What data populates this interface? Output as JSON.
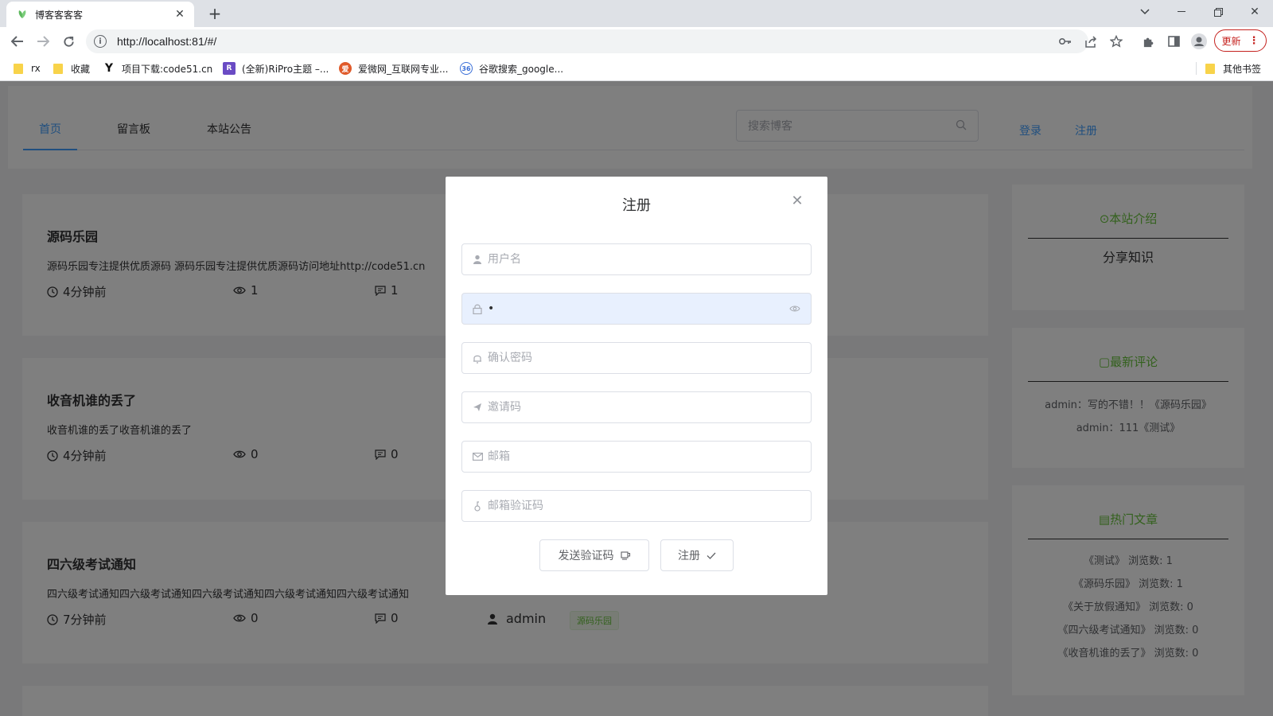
{
  "browser": {
    "tab_title": "博客客客客",
    "url": "http://localhost:81/#/",
    "update_label": "更新",
    "bookmarks": [
      "rx",
      "收藏",
      "项目下载:code51.cn",
      "(全新)RiPro主题 –...",
      "爱微网_互联网专业...",
      "谷歌搜索_google...",
      "其他书签"
    ]
  },
  "header": {
    "tabs": [
      "首页",
      "留言板",
      "本站公告"
    ],
    "search_placeholder": "搜索博客",
    "login": "登录",
    "register": "注册"
  },
  "posts": [
    {
      "title": "源码乐园",
      "excerpt": "源码乐园专注提供优质源码 源码乐园专注提供优质源码访问地址http://code51.cn",
      "time": "4分钟前",
      "views": "1",
      "comments": "1"
    },
    {
      "title": "收音机谁的丢了",
      "excerpt": "收音机谁的丢了收音机谁的丢了",
      "time": "4分钟前",
      "views": "0",
      "comments": "0"
    },
    {
      "title": "四六级考试通知",
      "excerpt": "四六级考试通知四六级考试通知四六级考试通知四六级考试通知四六级考试通知",
      "time": "7分钟前",
      "views": "0",
      "comments": "0",
      "author": "admin",
      "tag": "源码乐园"
    }
  ],
  "sidebar": {
    "intro": {
      "title": "本站介绍",
      "text": "分享知识"
    },
    "comments": {
      "title": "最新评论",
      "items": [
        "admin：写的不错！！《源码乐园》",
        "admin：111《测试》"
      ]
    },
    "hot": {
      "title": "热门文章",
      "items": [
        "《测试》 浏览数: 1",
        "《源码乐园》 浏览数: 1",
        "《关于放假通知》 浏览数: 0",
        "《四六级考试通知》 浏览数: 0",
        "《收音机谁的丢了》 浏览数: 0"
      ]
    }
  },
  "dialog": {
    "title": "注册",
    "username_placeholder": "用户名",
    "password_value": "•",
    "confirm_placeholder": "确认密码",
    "invite_placeholder": "邀请码",
    "email_placeholder": "邮箱",
    "email_code_placeholder": "邮箱验证码",
    "send_code_label": "发送验证码",
    "submit_label": "注册"
  }
}
